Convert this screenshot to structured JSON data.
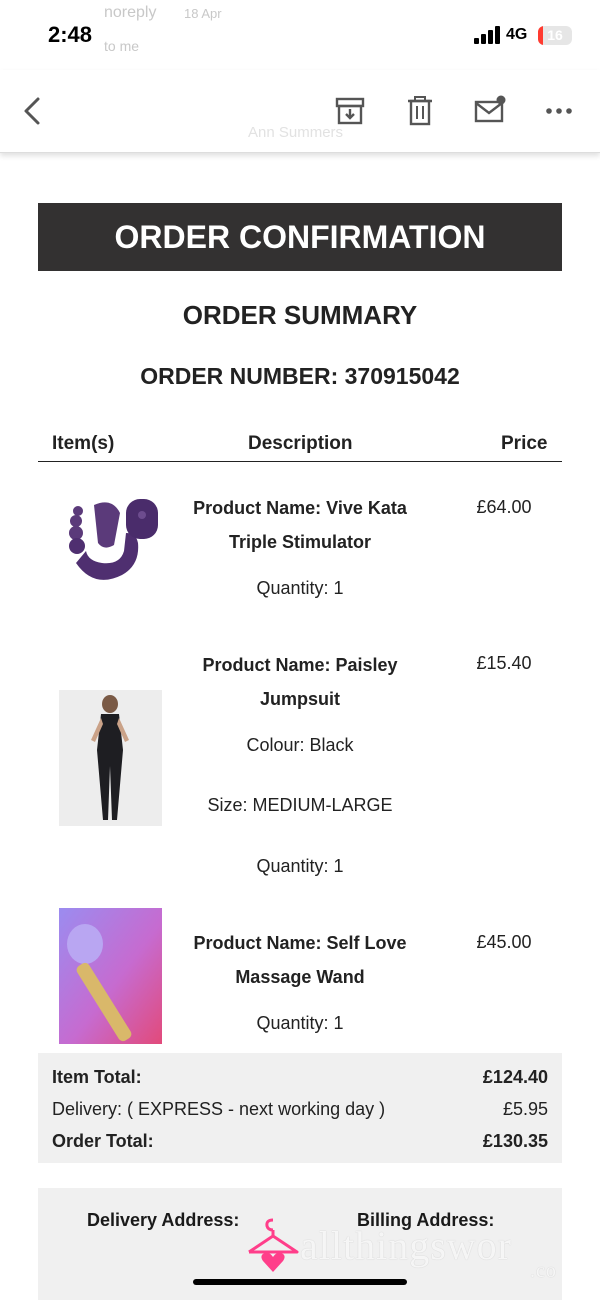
{
  "status": {
    "time": "2:48",
    "network": "4G",
    "battery": "16"
  },
  "behind": {
    "sender": "noreply",
    "date": "18 Apr",
    "to": "to me",
    "brand": "Ann Summers"
  },
  "toolbar": {
    "back": "back",
    "icons": [
      "archive-icon",
      "trash-icon",
      "mail-unread-icon",
      "more-icon"
    ]
  },
  "email": {
    "banner": "ORDER CONFIRMATION",
    "summary_title": "ORDER SUMMARY",
    "order_number": "ORDER NUMBER: 370915042",
    "headers": {
      "items": "Item(s)",
      "description": "Description",
      "price": "Price"
    },
    "products": [
      {
        "name_1": "Product Name: Vive Kata",
        "name_2": "Triple Stimulator",
        "quantity": "Quantity: 1",
        "price": "£64.00"
      },
      {
        "name_1": "Product Name: Paisley",
        "name_2": "Jumpsuit",
        "colour": "Colour: Black",
        "size": "Size: MEDIUM-LARGE",
        "quantity": "Quantity: 1",
        "price": "£15.40"
      },
      {
        "name_1": "Product Name: Self Love",
        "name_2": "Massage Wand",
        "quantity": "Quantity: 1",
        "price": "£45.00"
      }
    ],
    "totals": {
      "item_total_label": "Item Total:",
      "item_total": "£124.40",
      "delivery_label": "Delivery: ( EXPRESS - next working day )",
      "delivery": "£5.95",
      "order_total_label": "Order Total:",
      "order_total": "£130.35"
    },
    "address": {
      "delivery_label": "Delivery Address:",
      "billing_label": "Billing Address:"
    }
  },
  "watermark": {
    "text": "allthingswor",
    "suffix": ".co"
  },
  "colors": {
    "banner": "#333131",
    "panel": "#f0f0f0",
    "battery": "#ff3b30",
    "watermark": "#ff3e8a"
  }
}
